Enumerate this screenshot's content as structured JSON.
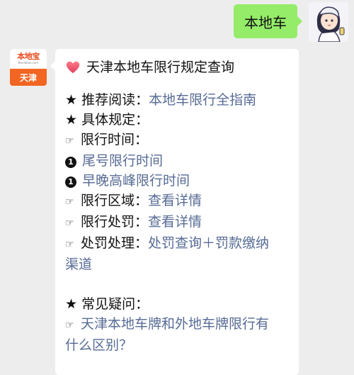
{
  "outgoing": {
    "text": "本地车"
  },
  "bot": {
    "logo_text": "本地宝",
    "logo_url": "Bendibao.com",
    "city": "天津"
  },
  "message": {
    "title": "天津本地车限行规定查询",
    "recommend_label": "★ 推荐阅读：",
    "recommend_link": "本地车限行全指南",
    "rules_label": "★ 具体规定：",
    "time_label": "限行时间：",
    "tail_link": "尾号限行时间",
    "peak_link": "早晚高峰限行时间",
    "area_label": "限行区域：",
    "area_link": "查看详情",
    "penalty_label": "限行处罚：",
    "penalty_link": "查看详情",
    "handle_label": "处罚处理：",
    "handle_link_line1": "处罚查询＋罚款缴纳",
    "handle_link_line2": "渠道",
    "faq_label": "★ 常见疑问：",
    "faq_link_line1": "天津本地车牌和外地车牌限行有",
    "faq_link_line2": "什么区别？"
  },
  "icons": {
    "heart": "heart-icon",
    "hand": "pointing-hand-icon",
    "number": "circled-one-icon",
    "user_avatar": "cartoon-girl-avatar"
  },
  "colors": {
    "outgoing_bubble": "#95ec69",
    "link": "#576b95",
    "chat_background": "#ededed",
    "logo_orange": "#f26522"
  }
}
